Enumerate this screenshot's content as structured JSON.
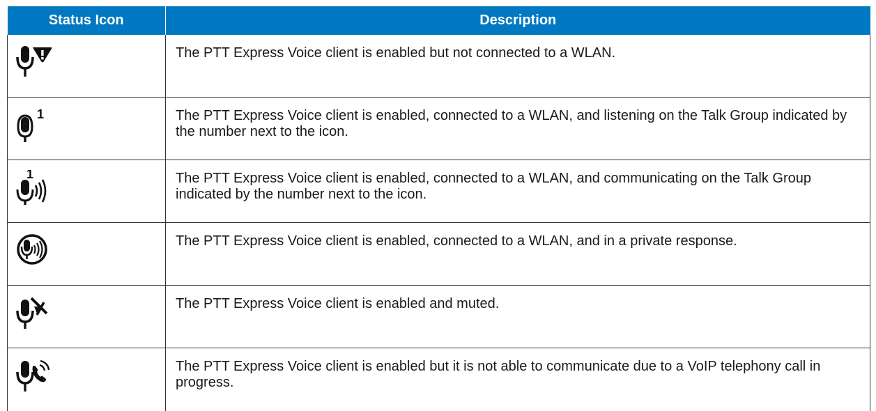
{
  "table": {
    "headers": {
      "icon": "Status Icon",
      "description": "Description"
    },
    "rows": [
      {
        "icon": "mic-alert-icon",
        "description": "The PTT Express Voice client is enabled but not connected to a WLAN."
      },
      {
        "icon": "mic-listening-icon",
        "superscript": "1",
        "description": "The PTT Express Voice client is enabled, connected to a WLAN, and listening on the Talk Group indicated by the number next to the icon."
      },
      {
        "icon": "mic-communicating-icon",
        "superscript": "1",
        "description": "The PTT Express Voice client is enabled, connected to a WLAN, and communicating on the Talk Group indicated by the number next to the icon."
      },
      {
        "icon": "mic-private-response-icon",
        "description": "The PTT Express Voice client is enabled, connected to a WLAN, and in a private response."
      },
      {
        "icon": "mic-muted-icon",
        "description": "The PTT Express Voice client is enabled and muted."
      },
      {
        "icon": "mic-voip-call-icon",
        "description": "The PTT Express Voice client is enabled but it is not able to communicate due to a VoIP telephony call in progress."
      }
    ]
  },
  "colors": {
    "header_bg": "#0079c2",
    "header_text": "#ffffff",
    "border": "#333333"
  }
}
